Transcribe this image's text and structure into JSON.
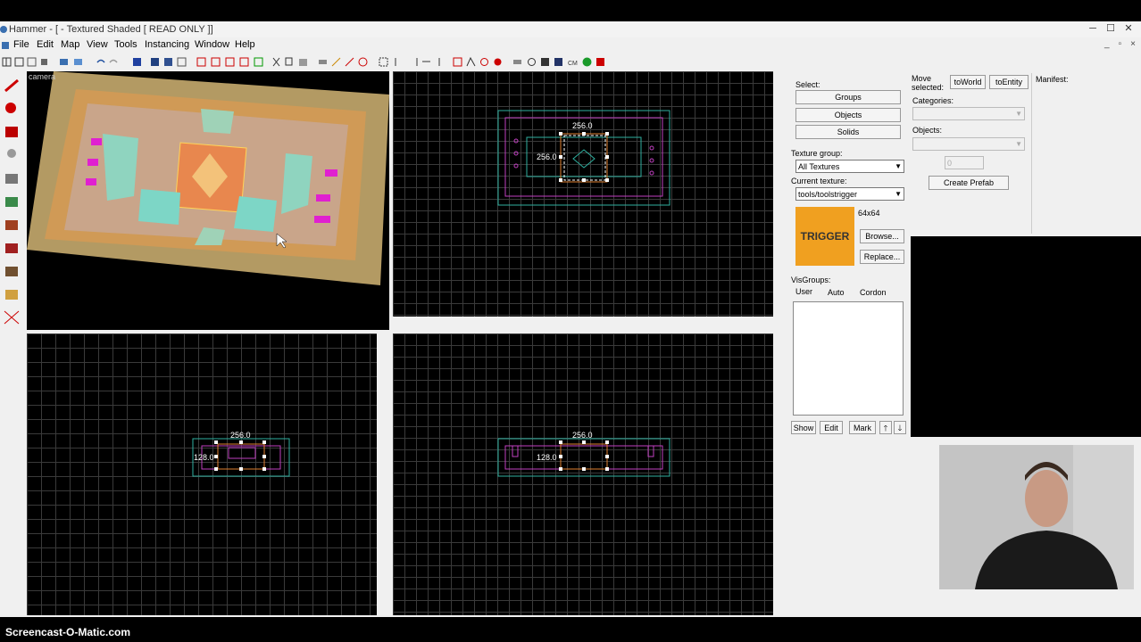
{
  "window": {
    "title": "Hammer - [ - Textured Shaded [ READ ONLY ]]",
    "controls": [
      "─",
      "☐",
      "✕"
    ]
  },
  "menu": [
    "File",
    "Edit",
    "Map",
    "View",
    "Tools",
    "Instancing",
    "Window",
    "Help"
  ],
  "camera_view": {
    "label": "camera"
  },
  "views": {
    "top": {
      "width_label": "256.0",
      "height_label": "256.0"
    },
    "front": {
      "width_label": "256.0",
      "height_label": "128.0"
    },
    "side": {
      "width_label": "256.0",
      "height_label": "128.0"
    }
  },
  "select_panel": {
    "label": "Select:",
    "buttons": [
      "Groups",
      "Objects",
      "Solids"
    ]
  },
  "texture": {
    "group_label": "Texture group:",
    "group_value": "All Textures",
    "current_label": "Current texture:",
    "current_value": "tools/toolstrigger",
    "size": "64x64",
    "preview_text": "TRIGGER",
    "preview_color": "#f0a020",
    "browse": "Browse...",
    "replace": "Replace..."
  },
  "visgroups": {
    "label": "VisGroups:",
    "tabs": [
      "User",
      "Auto",
      "Cordon"
    ],
    "actions": [
      "Show",
      "Edit",
      "Mark"
    ],
    "up_icon": "🡑",
    "down_icon": "🡓"
  },
  "move_panel": {
    "label_line1": "Move",
    "label_line2": "selected:",
    "to_world": "toWorld",
    "to_entity": "toEntity",
    "categories_label": "Categories:",
    "objects_label": "Objects:",
    "count_value": "0",
    "create_prefab": "Create Prefab"
  },
  "manifest": {
    "label": "Manifest:"
  },
  "footer": {
    "watermark": "Screencast-O-Matic.com"
  }
}
